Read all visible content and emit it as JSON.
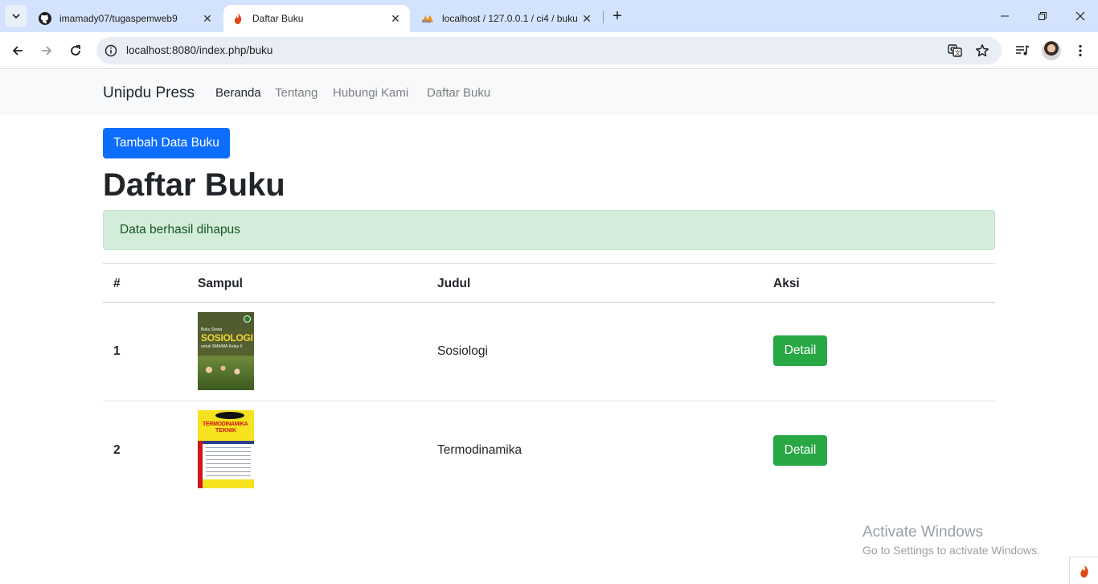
{
  "browser": {
    "tabs": [
      {
        "title": "imamady07/tugaspemweb9",
        "icon": "github-icon",
        "active": false
      },
      {
        "title": "Daftar Buku",
        "icon": "codeigniter-flame-icon",
        "active": true
      },
      {
        "title": "localhost / 127.0.0.1 / ci4 / buku",
        "icon": "phpmyadmin-icon",
        "active": false
      }
    ],
    "address": "localhost:8080/index.php/buku"
  },
  "navbar": {
    "brand": "Unipdu Press",
    "links": [
      {
        "label": "Beranda",
        "active": true
      },
      {
        "label": "Tentang",
        "active": false
      },
      {
        "label": "Hubungi Kami",
        "active": false
      },
      {
        "label": "Daftar Buku",
        "active": false
      }
    ]
  },
  "main": {
    "add_button": "Tambah Data Buku",
    "title": "Daftar Buku",
    "alert": "Data berhasil dihapus",
    "table": {
      "headers": [
        "#",
        "Sampul",
        "Judul",
        "Aksi"
      ],
      "rows": [
        {
          "num": "1",
          "cover_text": [
            "Buku Siswa",
            "SOSIOLOGI",
            "untuk SMA/MA Kelas X"
          ],
          "title": "Sosiologi",
          "action": "Detail"
        },
        {
          "num": "2",
          "cover_text": [
            "TERMODINAMIKA",
            "TEKNIK"
          ],
          "title": "Termodinamika",
          "action": "Detail"
        }
      ]
    }
  },
  "watermark": {
    "line1": "Activate Windows",
    "line2": "Go to Settings to activate Windows."
  },
  "colors": {
    "primary": "#0d6efd",
    "success": "#28a745",
    "alert_bg": "#d4edda",
    "alert_text": "#155724",
    "navbar_bg": "#f8f9fa"
  }
}
